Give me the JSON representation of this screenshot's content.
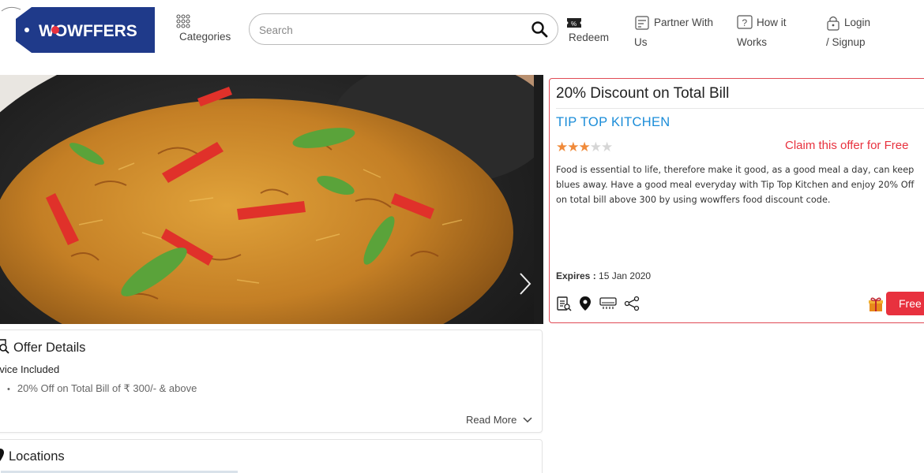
{
  "brand": {
    "logo_text": "WOWFFERS",
    "logo_bg": "#1f3a8a",
    "accent": "#e8313e"
  },
  "header": {
    "categories_label": "Categories",
    "search_placeholder": "Search",
    "redeem_label": "Redeem",
    "partner_line1": "Partner With",
    "partner_line2": "Us",
    "how_line1": "How it",
    "how_line2": "Works",
    "login_line1": "Login",
    "login_line2": "/ Signup",
    "icons": [
      "grid-icon",
      "search-icon",
      "ticket-icon",
      "partner-icon",
      "question-icon",
      "lock-icon"
    ]
  },
  "hero": {
    "image": "food-biryani-dish",
    "next_icon": "chevron-right-icon"
  },
  "offer": {
    "title": "20% Discount on Total Bill",
    "restaurant": "TIP TOP KITCHEN",
    "rating": 3,
    "rating_max": 5,
    "claim_text": "Claim this offer for Free",
    "description": "Food is essential to life, therefore make it good, as a good meal a day, can keep blues away. Have a good meal everyday with Tip Top Kitchen and enjoy 20% Off on total bill above 300 by using wowffers food discount code.",
    "expires_label": "Expires :",
    "expires_value": "15 Jan 2020",
    "action_icons": [
      "menu-icon",
      "location-pin-icon",
      "ac-icon",
      "share-icon"
    ],
    "free_button": "Free"
  },
  "details": {
    "title": "Offer Details",
    "service_label": "rvice Included",
    "items": [
      "20% Off on Total Bill of ₹ 300/- & above"
    ],
    "read_more": "Read More"
  },
  "locations": {
    "title": "Locations"
  }
}
